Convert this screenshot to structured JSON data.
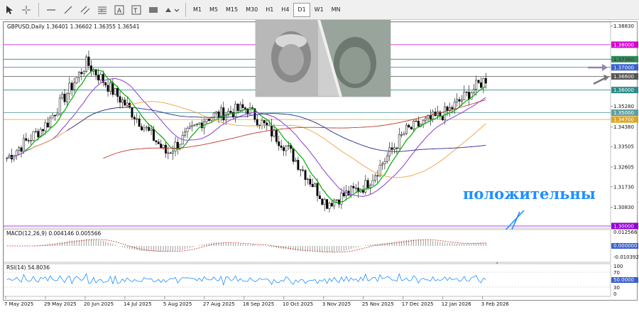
{
  "toolbar": {
    "tools": [
      {
        "name": "cursor-icon"
      },
      {
        "name": "crosshair-icon"
      },
      {
        "name": "horizontal-line-icon"
      },
      {
        "name": "trendline-icon"
      },
      {
        "name": "equidistant-channel-icon"
      },
      {
        "name": "fibonacci-icon"
      },
      {
        "name": "text-tool-icon"
      },
      {
        "name": "label-tool-icon"
      },
      {
        "name": "shapes-icon"
      },
      {
        "name": "more-objects-icon"
      }
    ],
    "timeframes": [
      "M1",
      "M5",
      "M15",
      "M30",
      "H1",
      "H4",
      "D1",
      "W1",
      "MN"
    ],
    "active_timeframe": "D1"
  },
  "chart": {
    "header": "GBPUSD,Daily  1.36401 1.36602 1.36355 1.36541",
    "annotation": "положительны",
    "price_axis": [
      "1.38830",
      "1.37360",
      "1.35280",
      "1.34380",
      "1.33505",
      "1.32605",
      "1.31730",
      "1.30830"
    ],
    "marked_levels": [
      {
        "label": "1.38000",
        "color": "#d400d4"
      },
      {
        "label": "1.37360",
        "color": "#2e8b57"
      },
      {
        "label": "1.37000",
        "color": "#3a5fcd"
      },
      {
        "label": "1.36600",
        "color": "#555555"
      },
      {
        "label": "1.36000",
        "color": "#2e8b8b"
      },
      {
        "label": "1.35000",
        "color": "#5f9ea0"
      },
      {
        "label": "1.34700",
        "color": "#daa520"
      },
      {
        "label": "1.30000",
        "color": "#9400d3"
      }
    ],
    "current_price": "1.36541"
  },
  "macd": {
    "label": "MACD(12,26,9) 0.004146 0.005566",
    "axis": [
      "0.012566",
      "0.000000",
      "-0.010392"
    ]
  },
  "rsi": {
    "label": "RSI(14) 54.8036",
    "axis": [
      "100",
      "70",
      "50.0000",
      "30",
      "0"
    ]
  },
  "date_axis": [
    "7 May 2025",
    "29 May 2025",
    "20 Jun 2025",
    "14 Jul 2025",
    "5 Aug 2025",
    "27 Aug 2025",
    "18 Sep 2025",
    "10 Oct 2025",
    "3 Nov 2025",
    "25 Nov 2025",
    "17 Dec 2025",
    "12 Jan 2026",
    "3 Feb 2026"
  ],
  "colors": {
    "candle": "#000000",
    "ma_fast": "#00aa00",
    "ma_mid": "#9b59d6",
    "ma_orange": "#f0a040",
    "ma_red": "#c0392b",
    "ma_navy": "#2c2c8c",
    "rsi_line": "#1e90ff",
    "macd_signal": "#c0392b",
    "annotation": "#1e90ff"
  },
  "chart_data": {
    "type": "line",
    "title": "",
    "xlabel": "",
    "ylabel": "",
    "x": [
      "7 May 2025",
      "29 May 2025",
      "20 Jun 2025",
      "14 Jul 2025",
      "5 Aug 2025",
      "27 Aug 2025",
      "18 Sep 2025",
      "10 Oct 2025",
      "3 Nov 2025",
      "25 Nov 2025",
      "17 Dec 2025",
      "12 Jan 2026",
      "3 Feb 2026"
    ],
    "series": [
      {
        "values": [
          1.33,
          1.345,
          1.372,
          1.353,
          1.332,
          1.348,
          1.352,
          1.335,
          1.31,
          1.318,
          1.342,
          1.35,
          1.365
        ]
      }
    ],
    "ylim": [
      1.3,
      1.39
    ]
  }
}
